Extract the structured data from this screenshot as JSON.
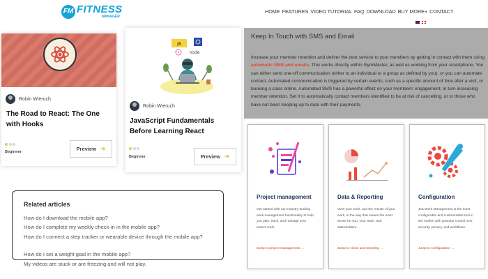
{
  "header": {
    "logo_badge": "FM",
    "logo_main": "FITNESS",
    "logo_sub": "MANAGER",
    "nav": [
      "HOME",
      "FEATURES",
      "VIDEO TUTORIAL",
      "FAQ",
      "DOWNLOAD",
      "BUY MORE+",
      "CONTACT"
    ]
  },
  "courses": [
    {
      "author": "Robin Wieruch",
      "title": "The Road to React: The One with Hooks",
      "level": "Beginner",
      "preview": "Preview",
      "level_dots": 1
    },
    {
      "author": "Robin Wieruch",
      "title": "JavaScript Fundamentals Before Learning React",
      "level": "Beginner",
      "preview": "Preview",
      "level_dots": 1
    }
  ],
  "related": {
    "title": "Related articles",
    "items": [
      "How do I download the mobile app?",
      "How do I complete my weekly check-in in the mobile app?",
      "How do I connect a step tracker or wearable device through the mobile app?",
      "How do I set a weight goal in the mobile app?",
      "My videos are stuck or are freezing and will not play."
    ]
  },
  "sms": {
    "title": "Keep In Touch with SMS and Email",
    "body_before": "Increase your member retention and deliver the best service to your members by getting in contact with them using ",
    "body_bold": "automatic SMS and emails",
    "body_after": ". This works directly within GymMaster, as well as working from your smartphone. You can either send one-off communication (either to an individual or a group as defined by you), or you can automate contact. Automated communication is triggered by certain events, such as a specific amount of time after a visit, or booking a class online. Automated SMS has a powerful effect on your members' engagement, in turn increasing member retention. Set it to automatically contact members identified to be at risk of cancelling, or to those who have not been keeping up to date with their payments."
  },
  "features": [
    {
      "title": "Project management",
      "desc": "Get started with our industry-leading work management functionality to help you plan, track, and manage your team's work.",
      "link": "Jump to project management →"
    },
    {
      "title": "Data & Reporting",
      "desc": "View your work, and the results of your work, in the way that makes the most sense for you, your team, and stakeholders.",
      "link": "Jump to views and reporting →"
    },
    {
      "title": "Configuration",
      "desc": "Jira Work Management is the most configurable and customizable tool in the market with granular control over security, privacy, and workflows.",
      "link": "Jump to configuration →"
    }
  ],
  "colors": {
    "brand": "#15a3d8",
    "accent_red": "#e8422e",
    "level_dot": "#e8c94a"
  }
}
